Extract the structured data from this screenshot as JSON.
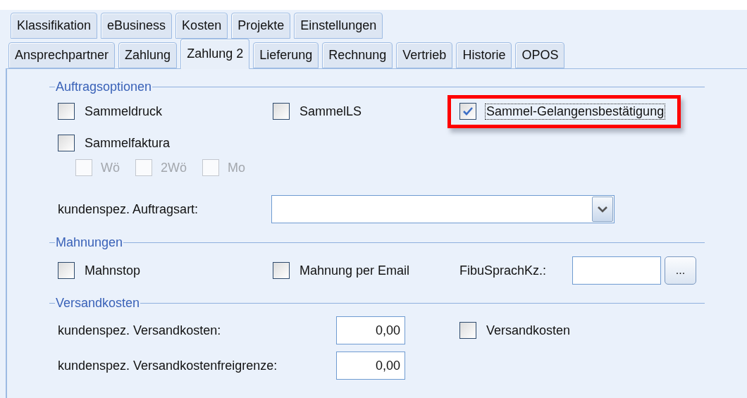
{
  "tabs_row_1": [
    {
      "label": "Klassifikation",
      "selected": false
    },
    {
      "label": "eBusiness",
      "selected": false
    },
    {
      "label": "Kosten",
      "selected": false
    },
    {
      "label": "Projekte",
      "selected": false
    },
    {
      "label": "Einstellungen",
      "selected": false
    }
  ],
  "tabs_row_2": [
    {
      "label": "Ansprechpartner",
      "selected": false
    },
    {
      "label": "Zahlung",
      "selected": false
    },
    {
      "label": "Zahlung 2",
      "selected": true
    },
    {
      "label": "Lieferung",
      "selected": false
    },
    {
      "label": "Rechnung",
      "selected": false
    },
    {
      "label": "Vertrieb",
      "selected": false
    },
    {
      "label": "Historie",
      "selected": false
    },
    {
      "label": "OPOS",
      "selected": false
    }
  ],
  "auftragsoptionen": {
    "title": "Auftragsoptionen",
    "options": [
      {
        "label": "Sammeldruck",
        "checked": false,
        "focused": false,
        "highlighted": false
      },
      {
        "label": "SammelLS",
        "checked": false,
        "focused": false,
        "highlighted": false
      },
      {
        "label": "Sammel-Gelangensbestätigung",
        "checked": true,
        "focused": true,
        "highlighted": true
      },
      {
        "label": "Sammelfaktura",
        "checked": false,
        "focused": false,
        "highlighted": false
      }
    ],
    "intervals": [
      {
        "label": "Wö",
        "checked": false,
        "disabled": true
      },
      {
        "label": "2Wö",
        "checked": false,
        "disabled": true
      },
      {
        "label": "Mo",
        "checked": false,
        "disabled": true
      }
    ],
    "order_type": {
      "label": "kundenspez. Auftragsart:"
    }
  },
  "mahnungen": {
    "title": "Mahnungen",
    "options": [
      {
        "label": "Mahnstop",
        "checked": false
      },
      {
        "label": "Mahnung per Email",
        "checked": false
      }
    ],
    "fibu": {
      "label": "FibuSprachKz.:",
      "button": "..."
    }
  },
  "versandkosten": {
    "title": "Versandkosten",
    "fields": [
      {
        "label": "kundenspez. Versandkosten:",
        "value": "0,00"
      },
      {
        "label": "kundenspez. Versandkostenfreigrenze:",
        "value": "0,00"
      }
    ],
    "option": {
      "label": "Versandkosten",
      "checked": false
    }
  }
}
